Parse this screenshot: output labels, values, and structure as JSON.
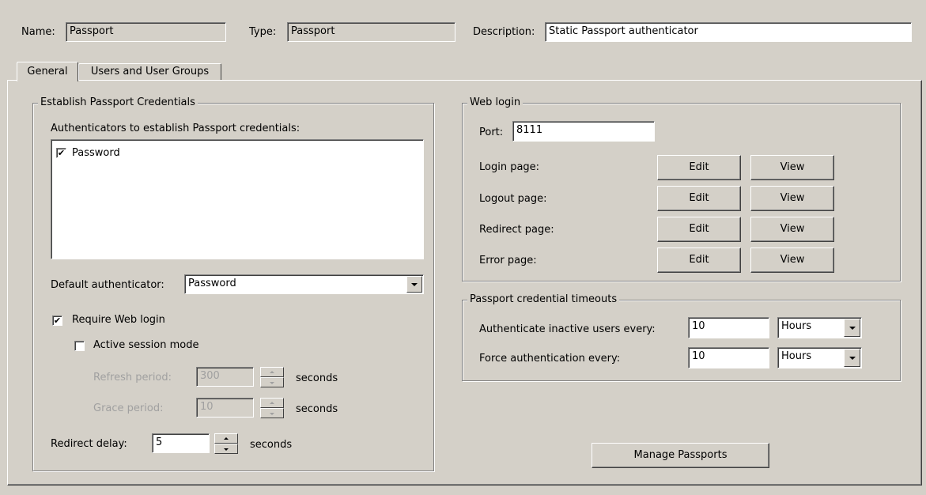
{
  "header": {
    "name_label": "Name:",
    "name_value": "Passport",
    "type_label": "Type:",
    "type_value": "Passport",
    "description_label": "Description:",
    "description_value": "Static Passport authenticator"
  },
  "tabs": [
    {
      "label": "General",
      "selected": true
    },
    {
      "label": "Users and User Groups",
      "selected": false
    }
  ],
  "credentials": {
    "legend": "Establish Passport Credentials",
    "authenticators_label": "Authenticators to establish Passport credentials:",
    "authenticators": [
      {
        "label": "Password",
        "checked": true
      }
    ],
    "default_auth_label": "Default authenticator:",
    "default_auth_value": "Password",
    "require_web_login_label": "Require Web login",
    "require_web_login_checked": true,
    "active_session_label": "Active session mode",
    "active_session_checked": false,
    "refresh_label": "Refresh period:",
    "refresh_value": "300",
    "refresh_unit": "seconds",
    "grace_label": "Grace period:",
    "grace_value": "10",
    "grace_unit": "seconds",
    "redirect_delay_label": "Redirect delay:",
    "redirect_delay_value": "5",
    "redirect_delay_unit": "seconds"
  },
  "web_login": {
    "legend": "Web login",
    "port_label": "Port:",
    "port_value": "8111",
    "edit_label": "Edit",
    "view_label": "View",
    "pages": [
      {
        "label": "Login page:"
      },
      {
        "label": "Logout page:"
      },
      {
        "label": "Redirect page:"
      },
      {
        "label": "Error page:"
      }
    ]
  },
  "timeouts": {
    "legend": "Passport credential timeouts",
    "inactive_label": "Authenticate inactive users every:",
    "inactive_value": "10",
    "inactive_unit": "Hours",
    "force_label": "Force authentication every:",
    "force_value": "10",
    "force_unit": "Hours"
  },
  "manage_passports_label": "Manage Passports"
}
